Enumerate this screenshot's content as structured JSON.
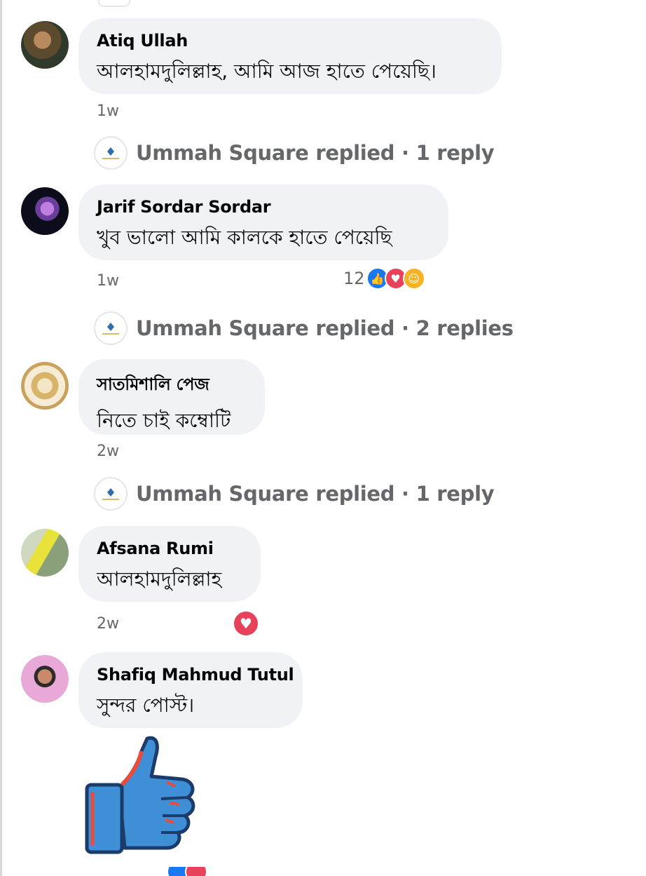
{
  "comments": [
    {
      "author": "Atiq Ullah",
      "text": "আলহামদুলিল্লাহ, আমি আজ হাতে পেয়েছি।",
      "time": "1w",
      "reply_summary": "Ummah Square replied · 1 reply"
    },
    {
      "author": "Jarif Sordar Sordar",
      "text": "খুব ভালো আমি কালকে হাতে পেয়েছি",
      "time": "1w",
      "reaction_count": "12",
      "reactions": [
        "like-icon",
        "love-icon",
        "care-icon"
      ],
      "reply_summary": "Ummah Square replied · 2 replies"
    },
    {
      "author": "সাতমিশালি পেজ",
      "text": "নিতে চাই কম্বোটি",
      "time": "2w",
      "reply_summary": "Ummah Square replied · 1 reply"
    },
    {
      "author": "Afsana Rumi",
      "text": "আলহামদুলিল্লাহ",
      "time": "2w",
      "reactions": [
        "love-icon"
      ]
    },
    {
      "author": "Shafiq Mahmud Tutul",
      "text": "সুন্দর পোস্ট।",
      "sticker": "thumbs-up-sticker"
    }
  ],
  "colors": {
    "bubble": "#f0f2f5",
    "meta_text": "#65676b",
    "like": "#1877f2",
    "love": "#e8415a",
    "care": "#f7b125"
  }
}
